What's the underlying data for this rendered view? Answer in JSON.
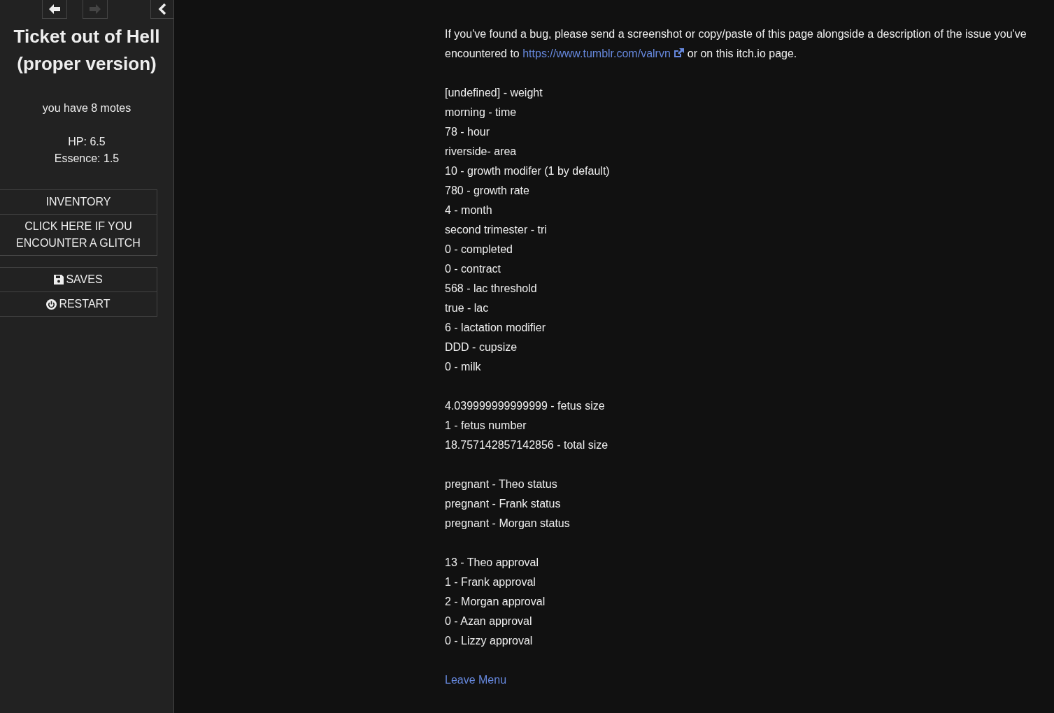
{
  "history": [
    {
      "kind": "back",
      "disabled": false
    },
    {
      "kind": "forward",
      "disabled": true
    }
  ],
  "sidebar": {
    "title": "Ticket out of Hell (proper version)",
    "motes": "you have 8 motes",
    "stats": [
      "HP: 6.5",
      "Essence: 1.5"
    ],
    "story_menu": [
      {
        "label": "INVENTORY"
      },
      {
        "label": "CLICK HERE IF YOU ENCOUNTER A GLITCH"
      }
    ],
    "core_menu": [
      {
        "label": "SAVES",
        "kind": "save"
      },
      {
        "label": "RESTART",
        "kind": "restart"
      }
    ]
  },
  "passage": {
    "intro_before": "If you've found a bug, please send a screenshot or copy/paste of this page alongside a description of the issue you've encountered to",
    "link": "https://www.tumblr.com/valrvn",
    "intro_after": "or on this itch.io page.",
    "groups": [
      [
        "[undefined] - weight",
        "morning - time",
        "78 - hour",
        "riverside- area",
        "10 - growth modifer (1 by default)",
        "780 - growth rate",
        "4 - month",
        "second trimester - tri",
        "0 - completed",
        "0 - contract",
        "568 - lac threshold",
        "true - lac",
        "6 - lactation modifier",
        "DDD - cupsize",
        "0 - milk"
      ],
      [
        "4.039999999999999 - fetus size",
        "1 - fetus number",
        "18.757142857142856 - total size"
      ],
      [
        "pregnant - Theo status",
        "pregnant - Frank status",
        "pregnant - Morgan status"
      ],
      [
        "13 - Theo approval",
        "1 - Frank approval",
        "2 - Morgan approval",
        "0 - Azan approval",
        "0 - Lizzy approval"
      ]
    ],
    "leave_link": "Leave Menu"
  }
}
